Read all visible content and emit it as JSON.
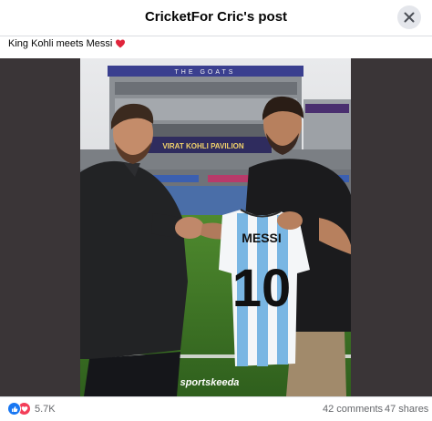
{
  "header": {
    "title": "CricketFor Cric's post"
  },
  "post": {
    "caption": "King Kohli meets Messi",
    "caption_emoji": "red-heart",
    "image": {
      "stand_banner": "THE GOATS",
      "pavilion_sign": "VIRAT KOHLI PAVILION",
      "jersey_name": "MESSI",
      "jersey_number": "10",
      "watermark": "sportskeeda"
    }
  },
  "footer": {
    "reaction_icons": [
      "like-icon",
      "love-icon"
    ],
    "reaction_count": "5.7K",
    "comments": "42 comments",
    "shares": "47 shares"
  },
  "colors": {
    "like": "#1877f2",
    "love": "#f33e58",
    "close_bg": "#e4e6eb",
    "muted_text": "#65676b"
  }
}
